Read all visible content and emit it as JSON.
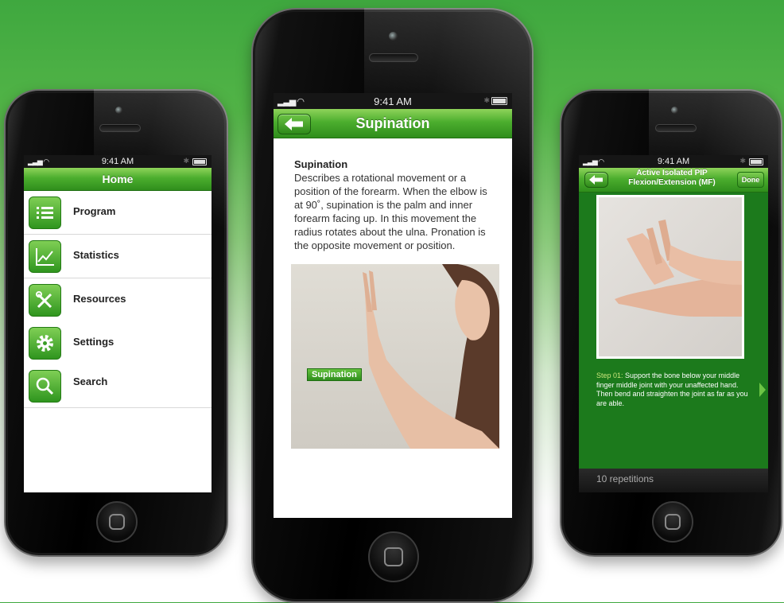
{
  "colors": {
    "accent_green": "#3fa83f",
    "navbar_green": "#4cae2e",
    "step_green": "#1c7a1c"
  },
  "left_phone": {
    "status_time": "9:41 AM",
    "nav_title": "Home",
    "menu_items": [
      {
        "label": "Program",
        "icon": "list-icon"
      },
      {
        "label": "Statistics",
        "icon": "chart-line-icon"
      },
      {
        "label": "Resources",
        "icon": "tools-icon"
      },
      {
        "label": "Settings",
        "icon": "gear-icon"
      },
      {
        "label": "Search",
        "icon": "search-icon"
      }
    ]
  },
  "center_phone": {
    "status_time": "9:41 AM",
    "nav_title": "Supination",
    "heading": "Supination",
    "body": "Describes a rotational movement or a position of the forearm. When the elbow is at 90˚, supination is the palm and inner forearm facing up. In this movement the radius rotates about the ulna. Pronation is the opposite movement or position.",
    "image_tag": "Supination"
  },
  "right_phone": {
    "status_time": "9:41 AM",
    "nav_title_line1": "Active Isolated PIP",
    "nav_title_line2": "Flexion/Extension (MF)",
    "done_label": "Done",
    "step_label": "Step 01:",
    "step_text": " Support the bone below your middle finger middle joint with your unaffected hand. Then bend and straighten the joint as far as you are able.",
    "repetitions": "10 repetitions"
  }
}
